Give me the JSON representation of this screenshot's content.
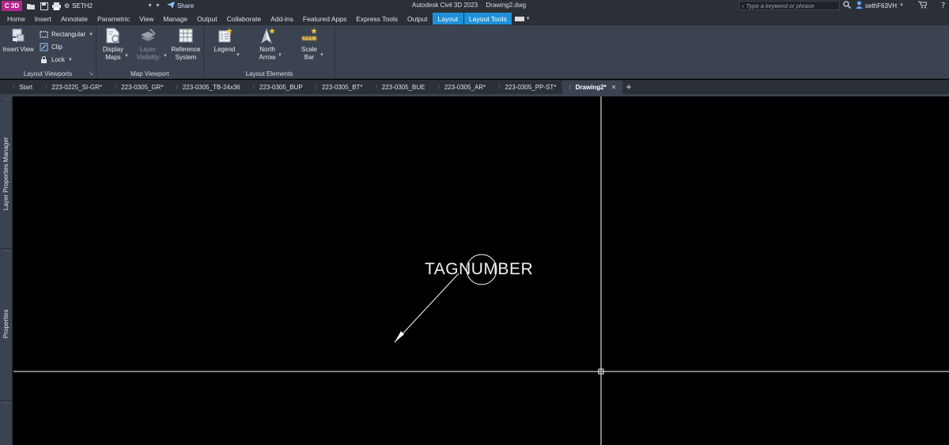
{
  "titlebar": {
    "app_logo": "C 3D",
    "workspace": "SETH2",
    "share_label": "Share",
    "app_name": "Autodesk Civil 3D 2023",
    "file_name": "Drawing2.dwg",
    "search_placeholder": "Type a keyword or phrase",
    "username": "sethF63VH"
  },
  "ribbon_tabs": [
    "Home",
    "Insert",
    "Annotate",
    "Parametric",
    "View",
    "Manage",
    "Output",
    "Collaborate",
    "Add-ins",
    "Featured Apps",
    "Express Tools",
    "Output",
    "Layout",
    "Layout Tools"
  ],
  "ribbon": {
    "layout_viewports": {
      "title": "Layout Viewports",
      "insert_view": "Insert View",
      "rectangular": "Rectangular",
      "clip": "Clip",
      "lock": "Lock"
    },
    "map_viewport": {
      "title": "Map Viewport",
      "display_maps_1": "Display",
      "display_maps_2": "Maps",
      "layer_visibility_1": "Layer",
      "layer_visibility_2": "Visibility",
      "reference_system_1": "Reference",
      "reference_system_2": "System"
    },
    "layout_elements": {
      "title": "Layout Elements",
      "legend": "Legend",
      "north_arrow_1": "North",
      "north_arrow_2": "Arrow",
      "scale_bar_1": "Scale",
      "scale_bar_2": "Bar"
    }
  },
  "doc_tabs": [
    "Start",
    "223-0225_SI-GR*",
    "223-0305_GR*",
    "223-0305_TB-24x36",
    "223-0305_BUP",
    "223-0305_BT*",
    "223-0305_BUE",
    "223-0305_AR*",
    "223-0305_PP-ST*"
  ],
  "active_doc_tab": "Drawing2*",
  "palettes": {
    "layer_manager": "Layer Properties Manager",
    "properties": "Properties"
  },
  "drawing": {
    "tag_text": "TAGNUMBER"
  },
  "colors": {
    "accent": "#1e90d8",
    "ribbon_bg": "#3b4350",
    "titlebar_bg": "#2b2f36",
    "canvas_bg": "#000000",
    "app_logo": "#b3288c"
  },
  "icons": {
    "search": "magnifier-icon",
    "user": "user-icon",
    "cart": "cart-icon",
    "help": "help-icon",
    "gear": "gear-icon"
  }
}
